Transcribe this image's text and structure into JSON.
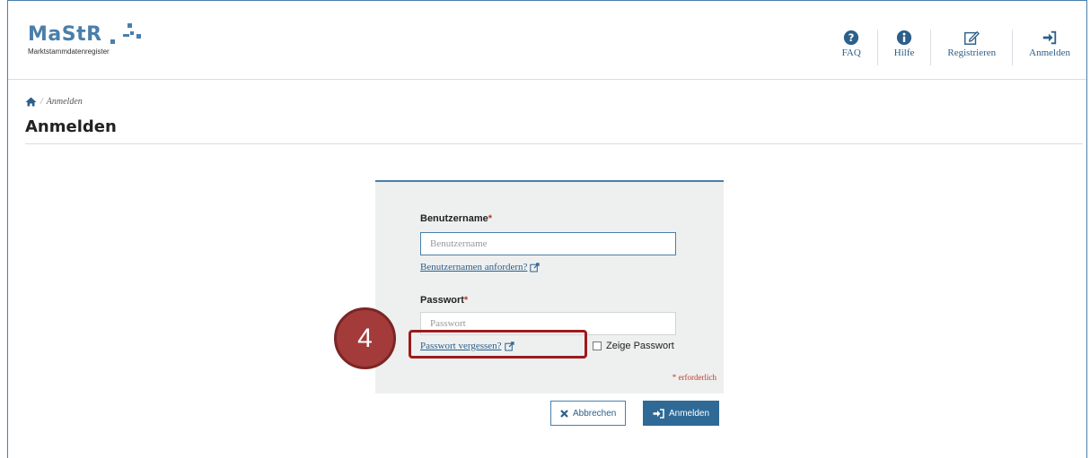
{
  "header": {
    "logo_text": "MaStR",
    "logo_subtitle": "Marktstammdatenregister",
    "nav": [
      {
        "label": "FAQ",
        "icon": "question-circle-icon"
      },
      {
        "label": "Hilfe",
        "icon": "info-circle-icon"
      },
      {
        "label": "Registrieren",
        "icon": "edit-icon"
      },
      {
        "label": "Anmelden",
        "icon": "sign-in-icon"
      }
    ]
  },
  "breadcrumb": {
    "current": "Anmelden"
  },
  "page_title": "Anmelden",
  "form": {
    "username_label": "Benutzername",
    "username_placeholder": "Benutzername",
    "request_username_link": "Benutzernamen anfordern?",
    "password_label": "Passwort",
    "password_placeholder": "Passwort",
    "forgot_password_link": "Passwort vergessen?",
    "show_password_label": "Zeige Passwort",
    "required_marker": "*",
    "required_note": "* erforderlich"
  },
  "buttons": {
    "cancel_label": "Abbrechen",
    "login_label": "Anmelden"
  },
  "annotation": {
    "step_number": "4"
  },
  "colors": {
    "brand": "#4a7eab",
    "primary_button": "#2f6a96",
    "required": "#c0392b",
    "annotation": "#a33b3b"
  }
}
